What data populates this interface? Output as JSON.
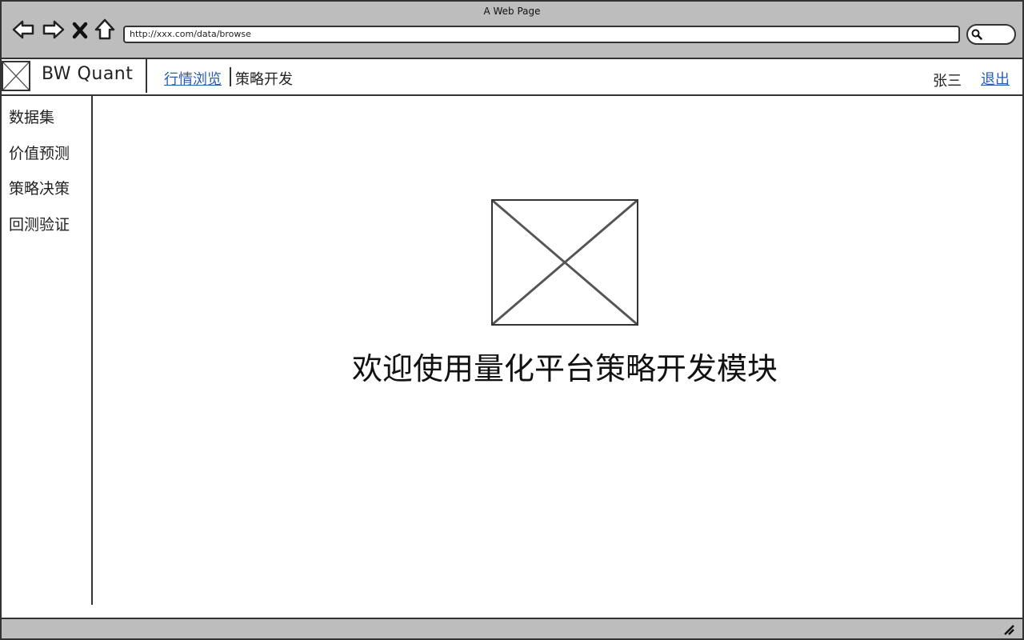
{
  "window": {
    "title": "A Web Page",
    "url": "http://xxx.com/data/browse"
  },
  "icons": {
    "back": "back-arrow-icon",
    "forward": "forward-arrow-icon",
    "stop": "close-icon",
    "home": "home-icon",
    "search": "search-icon",
    "logo": "image-placeholder-icon",
    "resize": "resize-grip-icon"
  },
  "header": {
    "brand": "BW Quant",
    "nav": [
      {
        "label": "行情浏览",
        "active": false,
        "link": true
      },
      {
        "label": "策略开发",
        "active": true,
        "link": false
      }
    ],
    "user": "张三",
    "logout": "退出"
  },
  "sidebar": {
    "items": [
      {
        "label": "数据集"
      },
      {
        "label": "价值预测"
      },
      {
        "label": "策略决策"
      },
      {
        "label": "回测验证"
      }
    ]
  },
  "main": {
    "welcome": "欢迎使用量化平台策略开发模块"
  },
  "colors": {
    "chrome": "#bdbdbd",
    "link": "#2a5db0",
    "border": "#333333"
  }
}
